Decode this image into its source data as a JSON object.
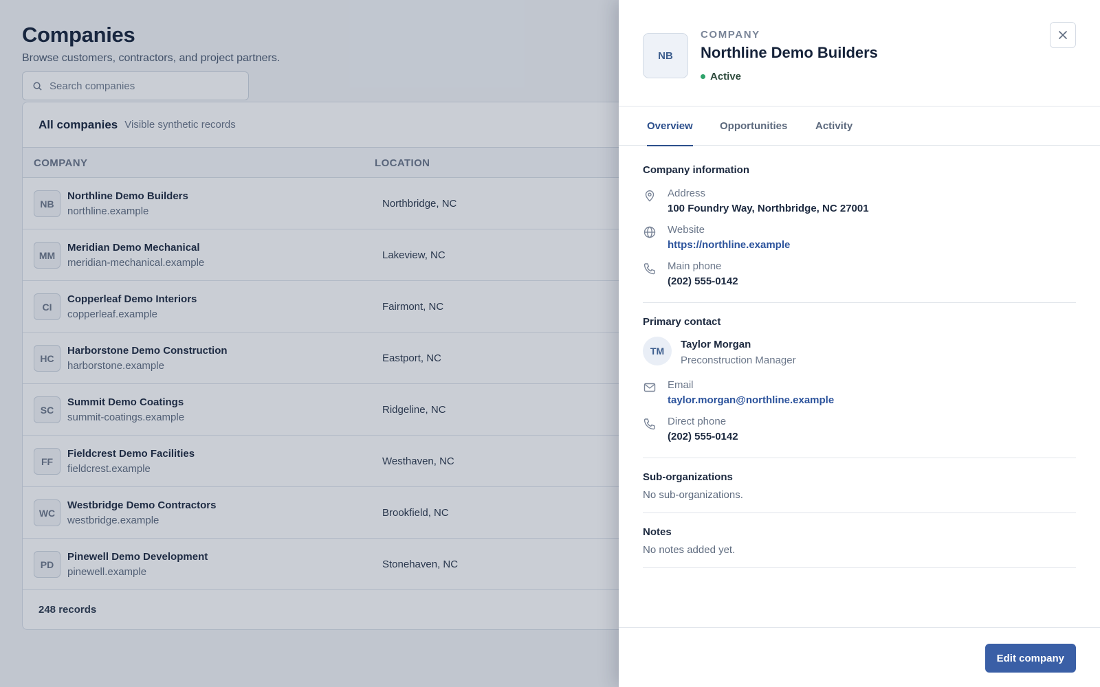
{
  "page": {
    "title": "Companies",
    "subtitle": "Browse customers, contractors, and project partners.",
    "search_placeholder": "Search companies"
  },
  "table": {
    "title": "All companies",
    "subtitle": "Visible synthetic records",
    "columns": [
      "COMPANY",
      "LOCATION"
    ],
    "rows": [
      {
        "initials": "NB",
        "name": "Northline Demo Builders",
        "domain": "northline.example",
        "location": "Northbridge, NC"
      },
      {
        "initials": "MM",
        "name": "Meridian Demo Mechanical",
        "domain": "meridian-mechanical.example",
        "location": "Lakeview, NC"
      },
      {
        "initials": "CI",
        "name": "Copperleaf Demo Interiors",
        "domain": "copperleaf.example",
        "location": "Fairmont, NC"
      },
      {
        "initials": "HC",
        "name": "Harborstone Demo Construction",
        "domain": "harborstone.example",
        "location": "Eastport, NC"
      },
      {
        "initials": "SC",
        "name": "Summit Demo Coatings",
        "domain": "summit-coatings.example",
        "location": "Ridgeline, NC"
      },
      {
        "initials": "FF",
        "name": "Fieldcrest Demo Facilities",
        "domain": "fieldcrest.example",
        "location": "Westhaven, NC"
      },
      {
        "initials": "WC",
        "name": "Westbridge Demo Contractors",
        "domain": "westbridge.example",
        "location": "Brookfield, NC"
      },
      {
        "initials": "PD",
        "name": "Pinewell Demo Development",
        "domain": "pinewell.example",
        "location": "Stonehaven, NC"
      }
    ],
    "footer": "248 records"
  },
  "drawer": {
    "initials": "NB",
    "eyebrow": "COMPANY",
    "title": "Northline Demo Builders",
    "status": "Active",
    "status_color": "#2ea36a",
    "tabs": [
      "Overview",
      "Opportunities",
      "Activity"
    ],
    "active_tab": "Overview",
    "company_info": {
      "title": "Company information",
      "address_label": "Address",
      "address": "100 Foundry Way, Northbridge, NC 27001",
      "website_label": "Website",
      "website": "https://northline.example",
      "phone_label": "Main phone",
      "phone": "(202) 555-0142"
    },
    "primary_contact": {
      "title": "Primary contact",
      "initials": "TM",
      "name": "Taylor Morgan",
      "role": "Preconstruction Manager",
      "email_label": "Email",
      "email": "taylor.morgan@northline.example",
      "phone_label": "Direct phone",
      "phone": "(202) 555-0142"
    },
    "sub_orgs": {
      "title": "Sub-organizations",
      "text": "No sub-organizations."
    },
    "notes": {
      "title": "Notes",
      "text": "No notes added yet."
    },
    "edit_label": "Edit company"
  },
  "colors": {
    "accent": "#3a5fa6",
    "link": "#2c539c",
    "overlay": "rgba(35,52,80,0.24)"
  }
}
